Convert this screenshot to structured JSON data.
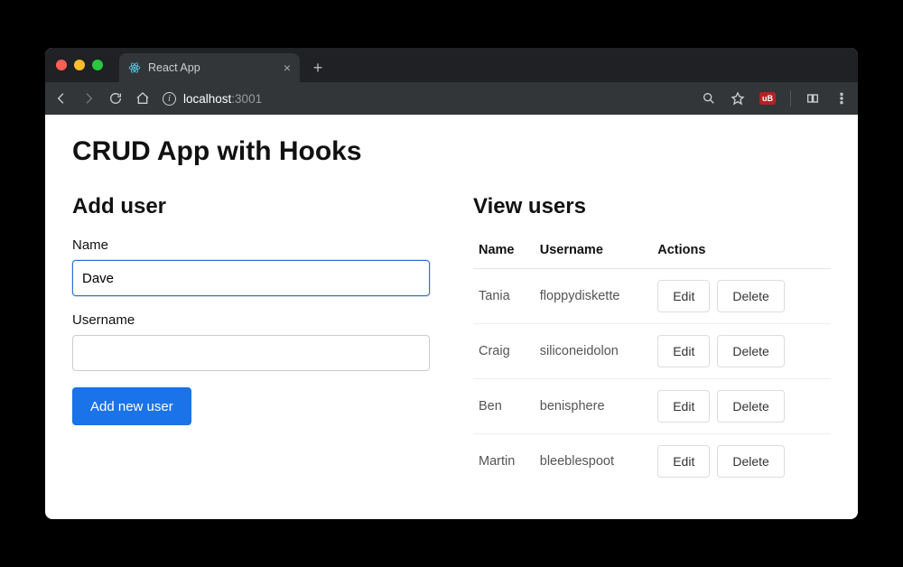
{
  "browser": {
    "tab_title": "React App",
    "url_host": "localhost",
    "url_port": ":3001",
    "ext_badge": "uB"
  },
  "page": {
    "title": "CRUD App with Hooks",
    "left_heading": "Add user",
    "right_heading": "View users",
    "form": {
      "name_label": "Name",
      "name_value": "Dave",
      "username_label": "Username",
      "username_value": "",
      "submit_label": "Add new user"
    },
    "table": {
      "columns": {
        "name": "Name",
        "username": "Username",
        "actions": "Actions"
      },
      "edit_label": "Edit",
      "delete_label": "Delete",
      "rows": [
        {
          "name": "Tania",
          "username": "floppydiskette"
        },
        {
          "name": "Craig",
          "username": "siliconeidolon"
        },
        {
          "name": "Ben",
          "username": "benisphere"
        },
        {
          "name": "Martin",
          "username": "bleeblespoot"
        }
      ]
    }
  }
}
